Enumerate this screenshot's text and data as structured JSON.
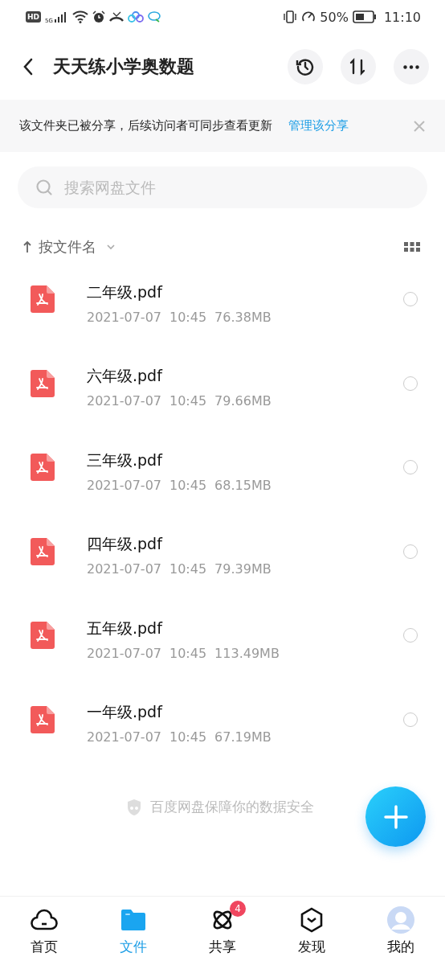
{
  "status_bar": {
    "network_badge": "HD",
    "network_type": "5G",
    "battery": "50%",
    "time": "11:10"
  },
  "header": {
    "title": "天天练小学奥数题"
  },
  "share_banner": {
    "message": "该文件夹已被分享，后续访问者可同步查看更新",
    "link": "管理该分享"
  },
  "search": {
    "placeholder": "搜索网盘文件"
  },
  "sort": {
    "label": "按文件名"
  },
  "files": [
    {
      "name": "二年级.pdf",
      "date": "2021-07-07",
      "time": "10:45",
      "size": "76.38MB",
      "selected": false
    },
    {
      "name": "六年级.pdf",
      "date": "2021-07-07",
      "time": "10:45",
      "size": "79.66MB",
      "selected": false
    },
    {
      "name": "三年级.pdf",
      "date": "2021-07-07",
      "time": "10:45",
      "size": "68.15MB",
      "selected": false
    },
    {
      "name": "四年级.pdf",
      "date": "2021-07-07",
      "time": "10:45",
      "size": "79.39MB",
      "selected": false
    },
    {
      "name": "五年级.pdf",
      "date": "2021-07-07",
      "time": "10:45",
      "size": "113.49MB",
      "selected": false
    },
    {
      "name": "一年级.pdf",
      "date": "2021-07-07",
      "time": "10:45",
      "size": "67.19MB",
      "selected": false
    }
  ],
  "footer_note": "百度网盘保障你的数据安全",
  "tabs": [
    {
      "label": "首页",
      "kind": "cloud",
      "selected": false
    },
    {
      "label": "文件",
      "kind": "folder",
      "selected": true
    },
    {
      "label": "共享",
      "kind": "orbit",
      "selected": false,
      "badge": "4"
    },
    {
      "label": "发现",
      "kind": "hexagon",
      "selected": false
    },
    {
      "label": "我的",
      "kind": "avatar",
      "selected": false
    }
  ]
}
